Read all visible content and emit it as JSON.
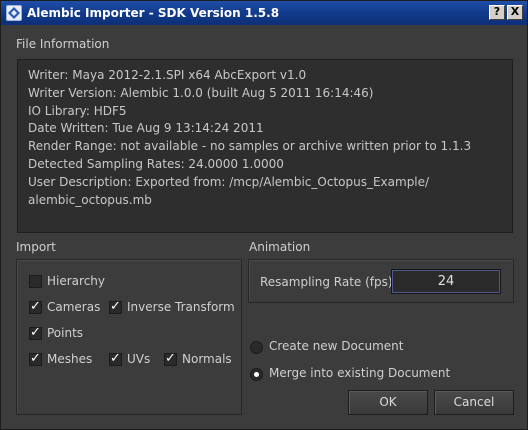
{
  "window": {
    "title": "Alembic Importer - SDK Version 1.5.8",
    "help_button": "?",
    "close_button": "X"
  },
  "file_information": {
    "heading": "File Information",
    "lines": [
      "Writer: Maya 2012-2.1.SPI x64 AbcExport v1.0",
      "Writer Version: Alembic 1.0.0 (built Aug  5 2011 16:14:46)",
      "IO Library: HDF5",
      "Date Written: Tue Aug  9 13:14:24 2011",
      "Render Range: not available - no samples or archive written prior to 1.1.3",
      "Detected Sampling Rates: 24.0000 1.0000",
      "User Description: Exported from: /mcp/Alembic_Octopus_Example/",
      "alembic_octopus.mb"
    ]
  },
  "import": {
    "heading": "Import",
    "hierarchy": {
      "label": "Hierarchy",
      "checked": false
    },
    "cameras": {
      "label": "Cameras",
      "checked": true
    },
    "inverse_transform": {
      "label": "Inverse Transform",
      "checked": true
    },
    "points": {
      "label": "Points",
      "checked": true
    },
    "meshes": {
      "label": "Meshes",
      "checked": true
    },
    "uvs": {
      "label": "UVs",
      "checked": true
    },
    "normals": {
      "label": "Normals",
      "checked": true
    }
  },
  "animation": {
    "heading": "Animation",
    "resampling_label": "Resampling Rate (fps):",
    "resampling_value": "24"
  },
  "document": {
    "create_new": {
      "label": "Create new Document",
      "selected": false
    },
    "merge_existing": {
      "label": "Merge into existing Document",
      "selected": true
    }
  },
  "buttons": {
    "ok": "OK",
    "cancel": "Cancel"
  },
  "colors": {
    "title_bar": "#123a8a",
    "background": "#3c3c3c",
    "info_box": "#2e2e2e"
  }
}
